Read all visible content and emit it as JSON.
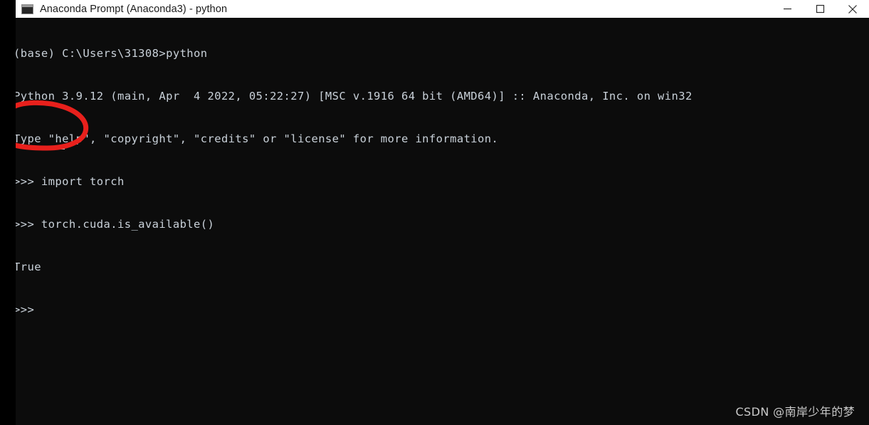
{
  "window": {
    "title": "Anaconda Prompt (Anaconda3) - python",
    "icon": "console-icon",
    "titlebar_bg": "#ffffff",
    "console_bg": "#0c0c0c",
    "console_fg": "#c9d1d9",
    "controls": [
      {
        "name": "minimize",
        "label": "—"
      },
      {
        "name": "maximize",
        "label": "□"
      },
      {
        "name": "close",
        "label": "✕"
      }
    ]
  },
  "console": {
    "lines": [
      "(base) C:\\Users\\31308>python",
      "Python 3.9.12 (main, Apr  4 2022, 05:22:27) [MSC v.1916 64 bit (AMD64)] :: Anaconda, Inc. on win32",
      "Type \"help\", \"copyright\", \"credits\" or \"license\" for more information.",
      ">>> import torch",
      ">>> torch.cuda.is_available()",
      "True",
      ">>> "
    ],
    "cursor": "_"
  },
  "annotation": {
    "shape": "hand-drawn-ellipse",
    "color": "#e8201c",
    "stroke_width": 7,
    "encircles": "True"
  },
  "watermark": {
    "text": "CSDN @南岸少年的梦",
    "color": "#c9c9c9"
  }
}
